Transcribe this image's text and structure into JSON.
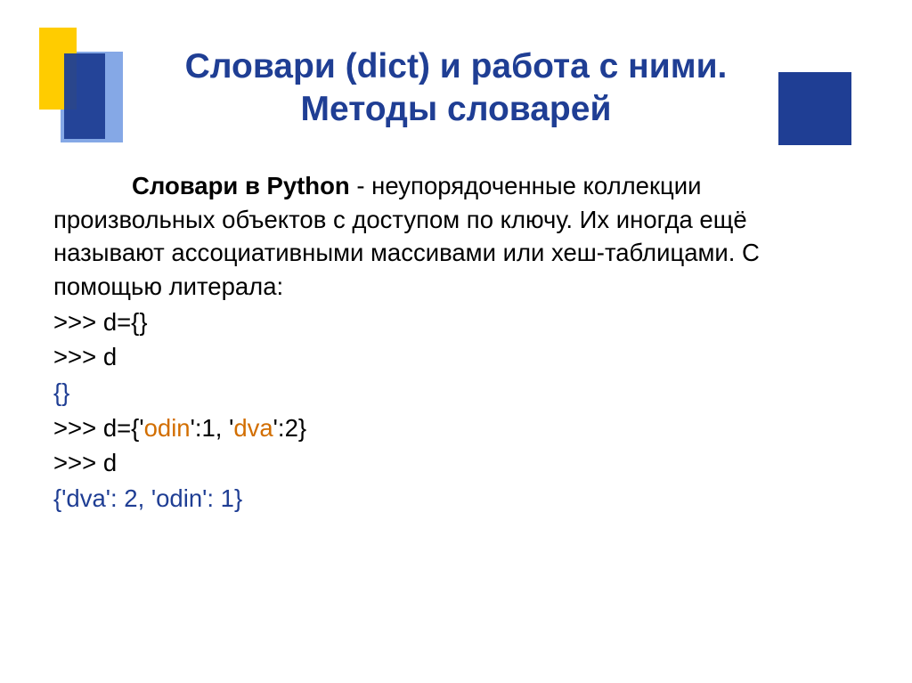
{
  "title_line1": "Словари (dict) и работа с ними.",
  "title_line2": "Методы словарей",
  "para_lead": "Словари в Python",
  "para_rest": " - неупорядоченные коллекции произвольных объектов с доступом по ключу. Их иногда ещё называют ассоциативными массивами или хеш-таблицами. С помощью литерала:",
  "code": {
    "l1": ">>> d={}",
    "l2": ">>> d",
    "l3": "{}",
    "l4_a": ">>> d={'",
    "l4_s1": "odin",
    "l4_b": "':1, '",
    "l4_s2": "dva",
    "l4_c": "':2}",
    "l5": ">>> d",
    "l6": "{'dva': 2, 'odin': 1}"
  }
}
